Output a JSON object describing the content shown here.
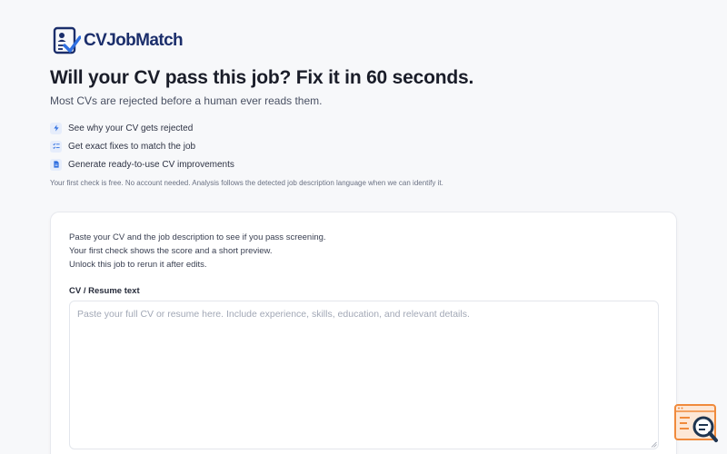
{
  "brand": {
    "name": "CVJobMatch",
    "color": "#1b2e6b",
    "accent": "#2f6fe0"
  },
  "hero": {
    "headline": "Will your CV pass this job? Fix it in 60 seconds.",
    "subhead": "Most CVs are rejected before a human ever reads them.",
    "features": [
      {
        "icon": "bolt-icon",
        "text": "See why your CV gets rejected"
      },
      {
        "icon": "list-check-icon",
        "text": "Get exact fixes to match the job"
      },
      {
        "icon": "document-icon",
        "text": "Generate ready-to-use CV improvements"
      }
    ],
    "fine_print": "Your first check is free. No account needed. Analysis follows the detected job description language when we can identify it."
  },
  "form": {
    "intro": [
      "Paste your CV and the job description to see if you pass screening.",
      "Your first check shows the score and a short preview.",
      "Unlock this job to rerun it after edits."
    ],
    "cv_label": "CV / Resume text",
    "cv_placeholder": "Paste your full CV or resume here. Include experience, skills, education, and relevant details.",
    "cv_value": ""
  },
  "widget": {
    "icon": "search-feedback-icon",
    "accent": "#f08a3c"
  }
}
